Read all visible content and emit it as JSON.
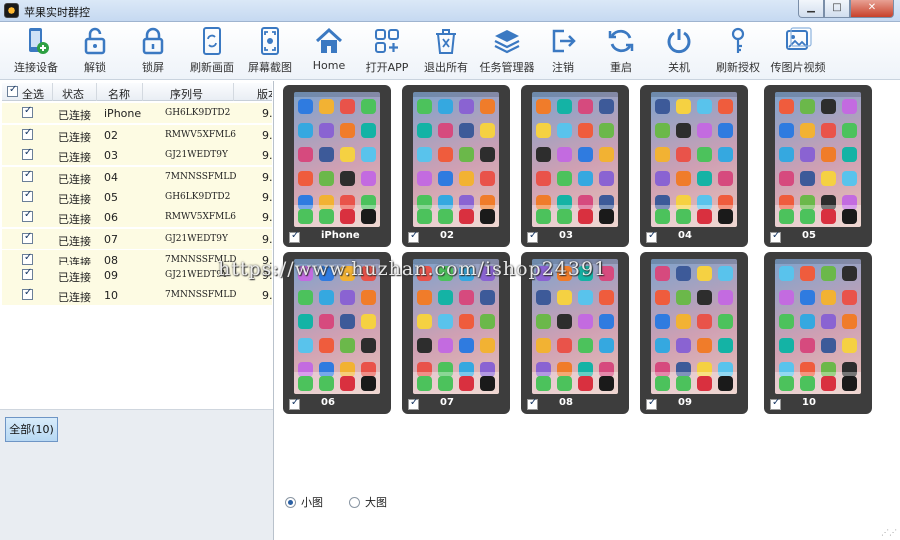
{
  "window": {
    "title": "苹果实时群控",
    "controls": {
      "minimize": "▁",
      "maximize": "□",
      "close": "✕"
    }
  },
  "toolbar": [
    {
      "label": "连接设备",
      "icon": "phone-add-icon"
    },
    {
      "label": "解锁",
      "icon": "unlock-icon"
    },
    {
      "label": "锁屏",
      "icon": "lock-icon"
    },
    {
      "label": "刷新画面",
      "icon": "refresh-screen-icon"
    },
    {
      "label": "屏幕截图",
      "icon": "screenshot-icon"
    },
    {
      "label": "Home",
      "icon": "home-icon"
    },
    {
      "label": "打开APP",
      "icon": "apps-add-icon"
    },
    {
      "label": "退出所有",
      "icon": "trash-exit-icon"
    },
    {
      "label": "任务管理器",
      "icon": "layers-icon"
    },
    {
      "label": "注销",
      "icon": "logout-icon"
    },
    {
      "label": "重启",
      "icon": "restart-icon"
    },
    {
      "label": "关机",
      "icon": "power-icon"
    },
    {
      "label": "刷新授权",
      "icon": "key-icon"
    },
    {
      "label": "传图片视频",
      "icon": "image-upload-icon"
    }
  ],
  "device_list": {
    "headers": {
      "select_all": "全选",
      "status": "状态",
      "name": "名称",
      "serial": "序列号",
      "version": "版本"
    },
    "rows": [
      {
        "status": "已连接",
        "name": "iPhone",
        "serial": "GH6LK9DTD2",
        "version": "9."
      },
      {
        "status": "已连接",
        "name": "02",
        "serial": "RMWV5XFML6",
        "version": "9."
      },
      {
        "status": "已连接",
        "name": "03",
        "serial": "GJ21WEDT9Y",
        "version": "9."
      },
      {
        "status": "已连接",
        "name": "04",
        "serial": "7MNNSSFMLD",
        "version": "9."
      },
      {
        "status": "已连接",
        "name": "05",
        "serial": "GH6LK9DTD2",
        "version": "9."
      },
      {
        "status": "已连接",
        "name": "06",
        "serial": "RMWV5XFML6",
        "version": "9."
      },
      {
        "status": "已连接",
        "name": "07",
        "serial": "GJ21WEDT9Y",
        "version": "9."
      },
      {
        "status": "已连接",
        "name": "08",
        "serial": "7MNNSSFMLD",
        "version": "9."
      },
      {
        "status": "已连接",
        "name": "09",
        "serial": "GJ21WEDT9Y",
        "version": "9."
      },
      {
        "status": "已连接",
        "name": "10",
        "serial": "7MNNSSFMLD",
        "version": "9."
      }
    ],
    "group_button": "全部(10)"
  },
  "phones": [
    "iPhone",
    "02",
    "03",
    "04",
    "05",
    "06",
    "07",
    "08",
    "09",
    "10"
  ],
  "view_mode": {
    "small": "小图",
    "large": "大图",
    "selected": "small"
  },
  "watermark": "https://www.huzhan.com/ishop24391",
  "colors": {
    "row_bg": "#fdfbe3",
    "accent": "#2a7fc9",
    "phone_bezel": "#3d3d3d"
  }
}
